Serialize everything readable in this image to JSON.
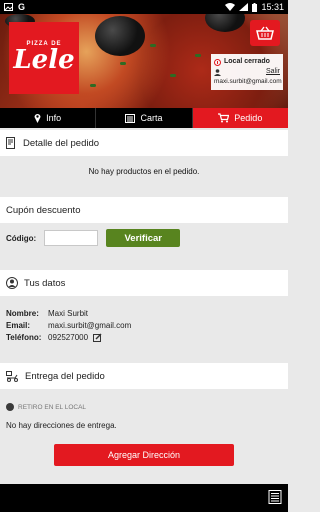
{
  "status_bar": {
    "time": "15:31",
    "notification_icons": [
      "image-icon",
      "google-icon"
    ],
    "system_icons": [
      "wifi-icon",
      "signal-icon",
      "battery-icon"
    ]
  },
  "header": {
    "logo_text_small": "PIZZA DE",
    "logo_text": "Lele",
    "status": "Local cerrado",
    "logout": "Salir",
    "email": "maxi.surbit@gmail.com",
    "brand_color": "#e31920"
  },
  "tabs": [
    {
      "label": "Info",
      "icon": "location-pin-icon",
      "active": false
    },
    {
      "label": "Carta",
      "icon": "menu-book-icon",
      "active": false
    },
    {
      "label": "Pedido",
      "icon": "shopping-cart-icon",
      "active": true
    }
  ],
  "order_detail": {
    "title": "Detalle del pedido",
    "empty_message": "No hay productos en el pedido."
  },
  "coupon": {
    "title": "Cupón descuento",
    "code_label": "Código:",
    "code_value": "",
    "verify_button": "Verificar",
    "verify_color": "#58841f"
  },
  "your_data": {
    "title": "Tus datos",
    "name_label": "Nombre:",
    "name_value": "Maxi Surbit",
    "email_label": "Email:",
    "email_value": "maxi.surbit@gmail.com",
    "phone_label": "Teléfono:",
    "phone_value": "092527000"
  },
  "delivery": {
    "title": "Entrega del pedido",
    "pickup_option": "RETIRO EN EL LOCAL",
    "no_address_message": "No hay direcciones de entrega.",
    "add_address_button": "Agregar Dirección"
  }
}
